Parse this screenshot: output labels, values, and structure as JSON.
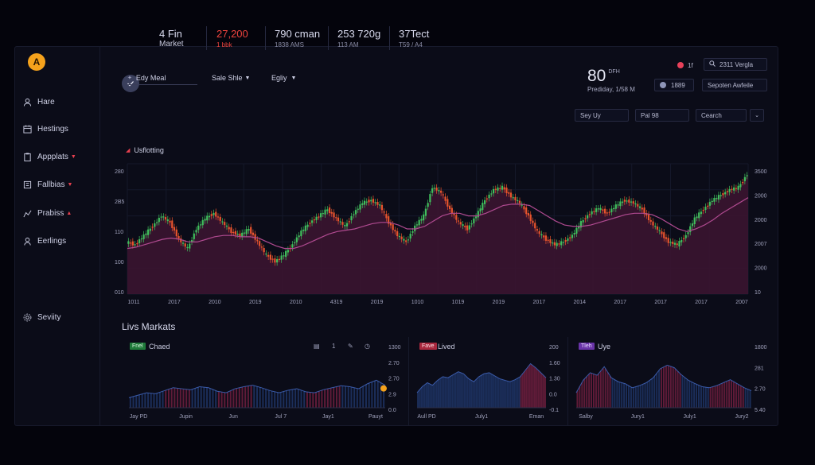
{
  "sidebar": {
    "logo": "A",
    "items": [
      {
        "label": "Hare",
        "icon": "user-icon",
        "caret": ""
      },
      {
        "label": "Hestings",
        "icon": "calendar-icon",
        "caret": ""
      },
      {
        "label": "Appplats",
        "icon": "clipboard-icon",
        "caret": "▼"
      },
      {
        "label": "Fallbias",
        "icon": "folder-icon",
        "caret": "▼"
      },
      {
        "label": "Prabiss",
        "icon": "chart-icon",
        "caret": "▲"
      },
      {
        "label": "Eerlings",
        "icon": "person-icon",
        "caret": ""
      }
    ],
    "settings_label": "Seviity"
  },
  "header": {
    "stats": [
      {
        "value": "4 Fin",
        "sub": "Market"
      },
      {
        "value": "27,200",
        "sub": "1 bbk"
      },
      {
        "value": "790 cman",
        "sub": "1838 AMS"
      },
      {
        "value": "253 720g",
        "sub": "113 AM"
      },
      {
        "value": "37Tect",
        "sub": "T59 / A4"
      }
    ],
    "big_value": "80",
    "big_value_sup": "DFH",
    "big_value_sub": "Prediday, 1/58 M",
    "notif_badge": "1f",
    "search_label": "2311 Vergla",
    "user_count": "1889",
    "filter_label": "Sepoten Awfeile"
  },
  "toolbar": {
    "buttons": [
      "Sey Uy",
      "Pal 98",
      "Cearch"
    ],
    "filters": [
      "Edy Meal",
      "Sale Shle",
      "Egliy"
    ]
  },
  "main_chart": {
    "subtitle": "Usflotting",
    "colors": {
      "up": "#3fbf5c",
      "down": "#e8542d",
      "area": "#3a1430",
      "ma": "#b04a90"
    }
  },
  "chart_data": [
    {
      "type": "line",
      "name": "main-candlestick",
      "title": "Usflotting",
      "x_tick_labels": [
        "1011",
        "2017",
        "2010",
        "2019",
        "2010",
        "4319",
        "2019",
        "1010",
        "1019",
        "2019",
        "2017",
        "2014",
        "2017",
        "2017",
        "2017",
        "2007"
      ],
      "y_left_tick_labels": [
        "280",
        "2B5",
        "110",
        "100",
        "010"
      ],
      "y_right_tick_labels": [
        "3500",
        "2000",
        "2000",
        "2007",
        "2000",
        "10"
      ],
      "ylim": [
        0,
        100
      ],
      "series": [
        {
          "values": [
            40,
            38,
            45,
            52,
            60,
            55,
            42,
            35,
            50,
            58,
            62,
            55,
            48,
            45,
            50,
            40,
            30,
            25,
            30,
            38,
            48,
            55,
            60,
            65,
            58,
            52,
            62,
            70,
            72,
            68,
            55,
            45,
            40,
            52,
            60,
            82,
            78,
            65,
            55,
            50,
            60,
            72,
            80,
            82,
            75,
            70,
            60,
            48,
            42,
            38,
            40,
            45,
            55,
            62,
            66,
            62,
            68,
            72,
            70,
            65,
            55,
            48,
            40,
            38,
            45,
            58,
            65,
            72,
            76,
            80,
            82,
            92
          ]
        },
        {
          "values": [
            35,
            36,
            38,
            40,
            42,
            43,
            42,
            40,
            40,
            42,
            44,
            45,
            45,
            44,
            44,
            43,
            40,
            37,
            35,
            35,
            37,
            40,
            43,
            46,
            48,
            49,
            50,
            52,
            54,
            55,
            55,
            53,
            50,
            50,
            52,
            56,
            60,
            62,
            62,
            60,
            60,
            62,
            65,
            68,
            69,
            69,
            68,
            64,
            60,
            56,
            53,
            52,
            52,
            53,
            55,
            57,
            59,
            61,
            62,
            62,
            61,
            58,
            54,
            50,
            48,
            50,
            53,
            57,
            62,
            66,
            70,
            74
          ]
        }
      ]
    },
    {
      "type": "area",
      "name": "panel-1",
      "title": "Chaed",
      "x_tick_labels": [
        "Jay PD",
        "Jupin",
        "Jun",
        "Jul 7",
        "Jay1",
        "Pauyt"
      ],
      "y_tick_labels": [
        "1300",
        "2.70",
        "2.70",
        "2.9",
        "0.0"
      ],
      "ylim": [
        0,
        100
      ],
      "series": [
        {
          "values": [
            20,
            25,
            30,
            28,
            34,
            40,
            38,
            36,
            42,
            40,
            33,
            30,
            38,
            42,
            45,
            40,
            34,
            30,
            35,
            38,
            32,
            30,
            36,
            40,
            44,
            42,
            38,
            48,
            55,
            45
          ]
        }
      ]
    },
    {
      "type": "area",
      "name": "panel-2",
      "title": "Lived",
      "x_tick_labels": [
        "Aull PD",
        "July1",
        "Eman"
      ],
      "y_tick_labels": [
        "200",
        "1.60",
        "1.30",
        "0.0",
        "-0.1"
      ],
      "ylim": [
        0,
        100
      ],
      "series": [
        {
          "values": [
            30,
            42,
            50,
            45,
            55,
            62,
            60,
            66,
            72,
            68,
            58,
            52,
            62,
            68,
            70,
            64,
            58,
            55,
            52,
            56,
            62,
            75,
            88,
            80,
            70,
            60
          ]
        }
      ]
    },
    {
      "type": "area",
      "name": "panel-3",
      "title": "Uye",
      "x_tick_labels": [
        "Salby",
        "Jury1",
        "July1",
        "Jury2"
      ],
      "y_tick_labels": [
        "1800",
        "281",
        "2.70",
        "5.40"
      ],
      "ylim": [
        0,
        100
      ],
      "series": [
        {
          "values": [
            30,
            55,
            70,
            65,
            82,
            60,
            52,
            48,
            40,
            44,
            50,
            60,
            78,
            85,
            80,
            66,
            55,
            48,
            42,
            40,
            44,
            50,
            56,
            48,
            40,
            34
          ]
        }
      ]
    }
  ],
  "live_markets": {
    "title": "Livs Markats",
    "panels": [
      {
        "tag": "Fnel",
        "tag_color": "#1f7a3a",
        "title": "Chaed"
      },
      {
        "tag": "Fave",
        "tag_color": "#a8283e",
        "title": "Lived"
      },
      {
        "tag": "Tleh",
        "tag_color": "#6a34a8",
        "title": "Uye"
      }
    ],
    "panel1_toolbar": [
      "1"
    ]
  }
}
